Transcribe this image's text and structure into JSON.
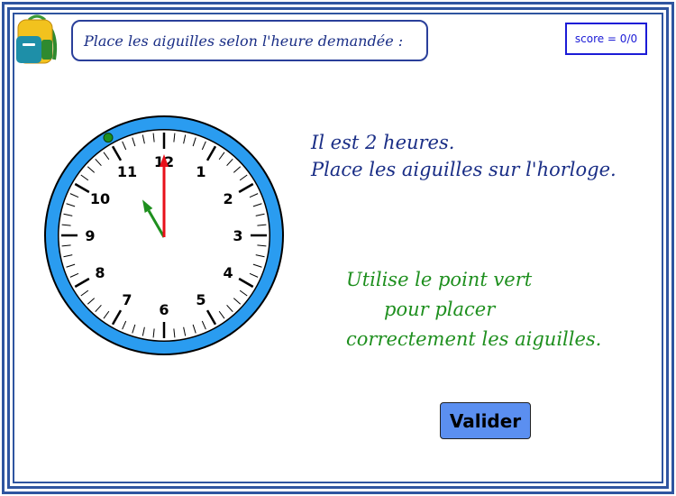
{
  "instruction": "Place les aiguilles selon l'heure demandée :",
  "score": {
    "label": "score = 0/0"
  },
  "question": {
    "line1": "Il est 2 heures.",
    "line2": "Place les aiguilles sur l'horloge."
  },
  "hint": {
    "line1": "Utilise  le point vert",
    "line2": "pour placer",
    "line3": "correctement les aiguilles."
  },
  "validate_label": "Valider",
  "clock": {
    "numbers": [
      "12",
      "1",
      "2",
      "3",
      "4",
      "5",
      "6",
      "7",
      "8",
      "9",
      "10",
      "11"
    ],
    "minute_hand_minutes": 0,
    "hour_hand_minutes": 55,
    "rim_color": "#2a9cf0",
    "minute_hand_color": "#e8101a",
    "hour_hand_color": "#1e8f1e"
  },
  "icons": {
    "backpack": "backpack-icon",
    "control_point": "green-handle-dot"
  }
}
